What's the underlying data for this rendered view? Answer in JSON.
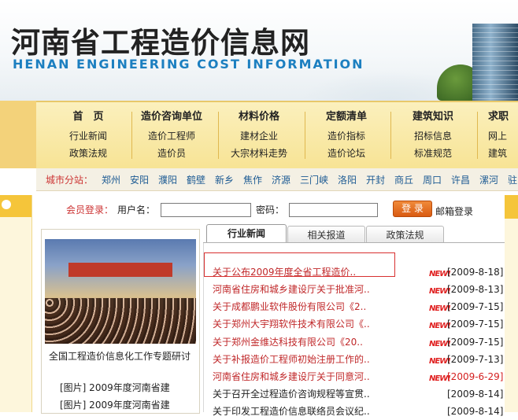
{
  "header": {
    "title_cn": "河南省工程造价信息网",
    "title_en": "HENAN ENGINEERING COST INFORMATION"
  },
  "nav": {
    "columns": [
      {
        "head": "首　页",
        "items": [
          "行业新闻",
          "政策法规"
        ]
      },
      {
        "head": "造价咨询单位",
        "items": [
          "造价工程师",
          "造价员"
        ]
      },
      {
        "head": "材料价格",
        "items": [
          "建材企业",
          "大宗材料走势"
        ]
      },
      {
        "head": "定额清单",
        "items": [
          "造价指标",
          "造价论坛"
        ]
      },
      {
        "head": "建筑知识",
        "items": [
          "招标信息",
          "标准规范"
        ]
      },
      {
        "head": "求职",
        "items": [
          "网上",
          "建筑"
        ]
      }
    ]
  },
  "city_bar": {
    "left_tab": "",
    "label": "城市分站：",
    "cities": [
      "郑州",
      "安阳",
      "濮阳",
      "鹤壁",
      "新乡",
      "焦作",
      "济源",
      "三门峡",
      "洛阳",
      "开封",
      "商丘",
      "周口",
      "许昌",
      "漯河",
      "驻"
    ]
  },
  "login": {
    "label": "会员登录：",
    "username_label": "用户名：",
    "password_label": "密码：",
    "username_value": "",
    "password_value": "",
    "login_button": "登 录",
    "mailbox": "邮箱登录"
  },
  "photo_panel": {
    "caption": "全国工程造价信息化工作专题研讨",
    "items": [
      "[图片] 2009年度河南省建",
      "[图片] 2009年度河南省建"
    ]
  },
  "tabs": [
    {
      "label": "行业新闻",
      "active": true
    },
    {
      "label": "相关报道",
      "active": false
    },
    {
      "label": "政策法规",
      "active": false
    }
  ],
  "news": [
    {
      "title": "关于公布2009年度全省工程造价..",
      "date": "[2009-8-18]",
      "title_red": true,
      "date_red": false
    },
    {
      "title": "河南省住房和城乡建设厅关于批准河..",
      "date": "[2009-8-13]",
      "title_red": true,
      "date_red": false
    },
    {
      "title": "关于成都鹏业软件股份有限公司《2..",
      "date": "[2009-7-15]",
      "title_red": true,
      "date_red": false
    },
    {
      "title": "关于郑州大宇翔软件技术有限公司《..",
      "date": "[2009-7-15]",
      "title_red": true,
      "date_red": false
    },
    {
      "title": "关于郑州金维达科技有限公司《20..",
      "date": "[2009-7-15]",
      "title_red": true,
      "date_red": false
    },
    {
      "title": "关于补报造价工程师初始注册工作的..",
      "date": "[2009-7-13]",
      "title_red": true,
      "date_red": false
    },
    {
      "title": "河南省住房和城乡建设厅关于同意河..",
      "date": "[2009-6-29]",
      "title_red": true,
      "date_red": true
    },
    {
      "title": "关于召开全过程造价咨询规程等宣贯..",
      "date": "[2009-8-14]",
      "title_red": false,
      "date_red": false
    },
    {
      "title": "关于印发工程造价信息联络员会议纪..",
      "date": "[2009-8-14]",
      "title_red": false,
      "date_red": false
    }
  ],
  "new_badge": "NEW!",
  "colors": {
    "accent_red": "#c0282a",
    "nav_bg": "#f7e394",
    "link_blue": "#1c5a93",
    "title_blue": "#1c7fc0"
  }
}
